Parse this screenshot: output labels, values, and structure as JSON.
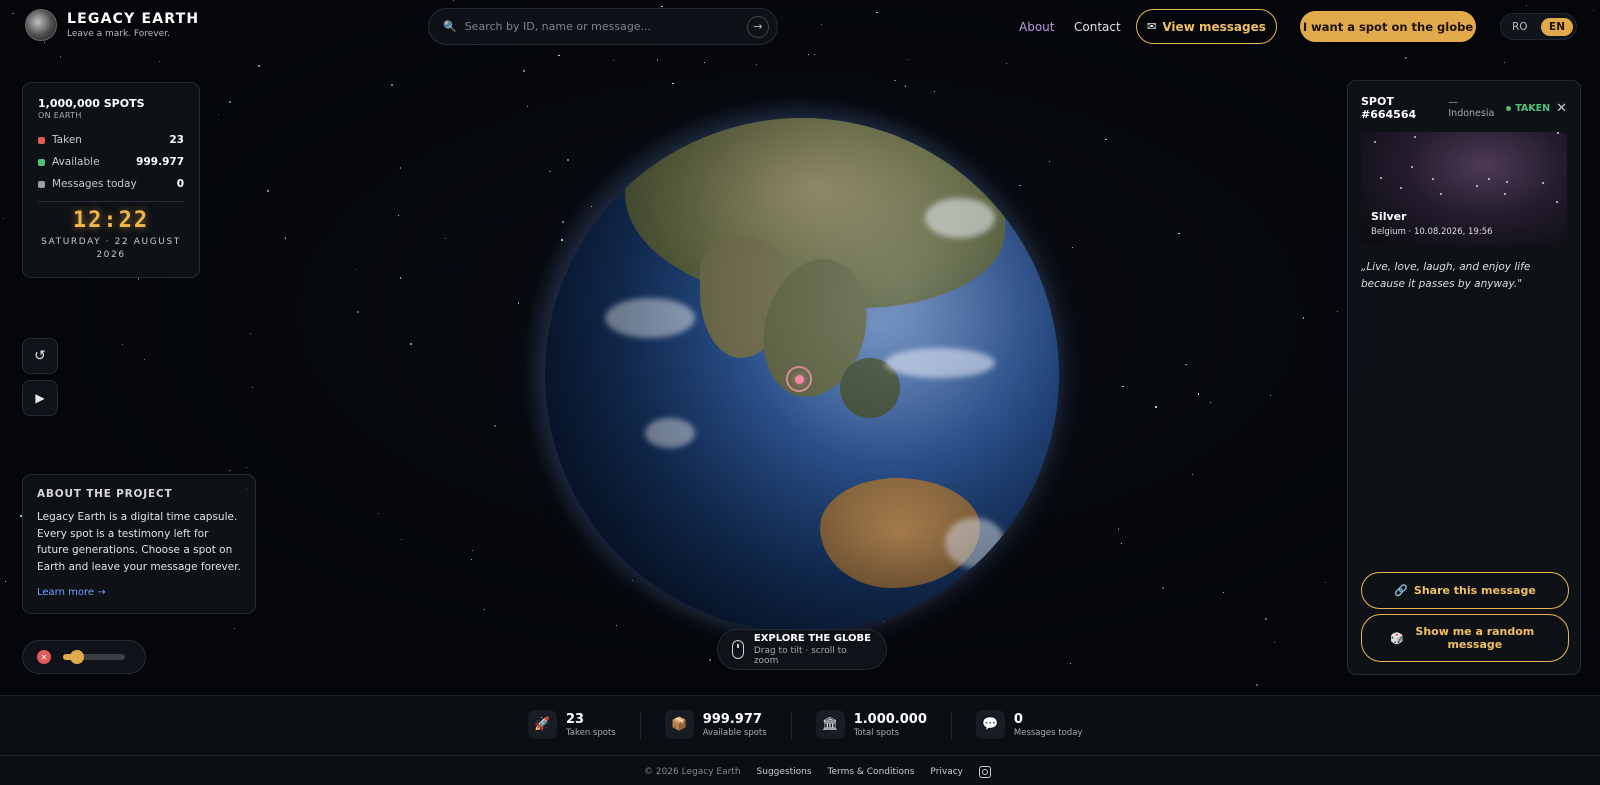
{
  "brand": {
    "title": "LEGACY EARTH",
    "tagline": "Leave a mark. Forever."
  },
  "search": {
    "placeholder": "Search by ID, name or message..."
  },
  "nav": {
    "about": "About",
    "contact": "Contact",
    "view_messages": "View messages",
    "want_spot": "I want a spot on the globe"
  },
  "lang": {
    "ro": "RO",
    "en": "EN",
    "active": "EN"
  },
  "stats": {
    "title": "1,000,000 SPOTS",
    "subtitle": "ON EARTH",
    "rows": [
      {
        "label": "Taken",
        "value": "23",
        "color": "#e25a5a"
      },
      {
        "label": "Available",
        "value": "999.977",
        "color": "#4fc27a"
      },
      {
        "label": "Messages today",
        "value": "0",
        "color": "#9aa0a8"
      }
    ],
    "clock": "12:22",
    "date": "SATURDAY · 22 AUGUST 2026"
  },
  "about": {
    "title": "ABOUT THE PROJECT",
    "text": "Legacy Earth is a digital time capsule. Every spot is a testimony left for future generations. Choose a spot on Earth and leave your message forever.",
    "link": "Learn more →"
  },
  "audio": {
    "muted": true,
    "volume_percent": 22
  },
  "explore": {
    "title": "EXPLORE THE GLOBE",
    "subtitle": "Drag to tilt · scroll to zoom"
  },
  "spot": {
    "id": "SPOT #664564",
    "country": "— Indonesia",
    "status": "TAKEN",
    "name": "Silver",
    "meta": "Belgium · 10.08.2026, 19:56",
    "message": "„Live, love, laugh, and enjoy life because it passes by anyway.\"",
    "share_label": "Share this message",
    "random_label": "Show me a random message"
  },
  "footer": {
    "stats": [
      {
        "value": "23",
        "label": "Taken spots",
        "icon": "rocket-icon"
      },
      {
        "value": "999.977",
        "label": "Available spots",
        "icon": "box-icon"
      },
      {
        "value": "1.000.000",
        "label": "Total spots",
        "icon": "building-icon"
      },
      {
        "value": "0",
        "label": "Messages today",
        "icon": "chat-icon"
      }
    ],
    "copyright": "© 2026 Legacy Earth",
    "links": [
      "Suggestions",
      "Terms & Conditions",
      "Privacy"
    ]
  },
  "colors": {
    "accent": "#e2a94b",
    "taken": "#e25a5a",
    "available": "#4fc27a",
    "link": "#6fa0ff"
  }
}
